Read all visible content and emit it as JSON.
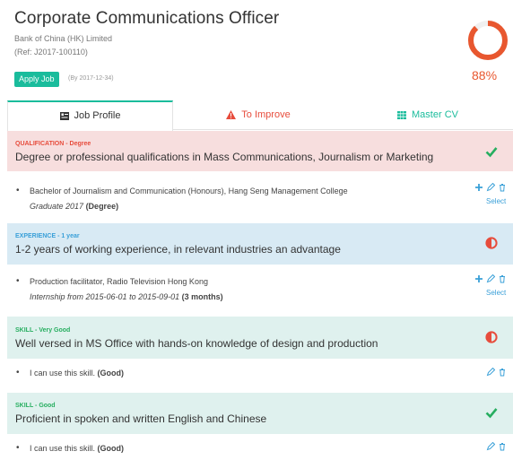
{
  "header": {
    "title": "Corporate Communications Officer",
    "company": "Bank of China (HK) Limited",
    "ref": "(Ref: J2017-100110)",
    "apply_label": "Apply Job",
    "deadline": "(By 2017-12-34)",
    "match_percent_label": "88%",
    "match_fraction": 0.88
  },
  "colors": {
    "accent": "#1abc9c",
    "danger": "#e74c3c",
    "gauge": "#e8572f",
    "link": "#3aa0d8"
  },
  "tabs": [
    {
      "label": "Job Profile",
      "icon": "profile-card-icon"
    },
    {
      "label": "To Improve",
      "icon": "warning-icon"
    },
    {
      "label": "Master CV",
      "icon": "grid-icon"
    }
  ],
  "requirements": [
    {
      "type_label": "QUALIFICATION - Degree",
      "text": "Degree or professional qualifications in Mass Communications, Journalism or Marketing",
      "status_icon": "check-icon",
      "entry": {
        "line": "Bachelor of Journalism and Communication (Honours), Hang Seng Management College",
        "sub_italic": "Graduate 2017",
        "sub_bold": "(Degree)",
        "select_label": "Select"
      }
    },
    {
      "type_label": "EXPERIENCE - 1 year",
      "text": "1-2 years of working experience, in relevant industries an advantage",
      "status_icon": "half-circle-icon",
      "entry": {
        "line": "Production facilitator, Radio Television Hong Kong",
        "sub_italic": "Internship from 2015-06-01 to 2015-09-01",
        "sub_bold": "(3 months)",
        "select_label": "Select"
      }
    },
    {
      "type_label": "SKILL - Very Good",
      "text": "Well versed in MS Office with hands-on knowledge of design and production",
      "status_icon": "half-circle-icon",
      "entry": {
        "line": "I can use this skill.",
        "line_bold": "(Good)"
      }
    },
    {
      "type_label": "SKILL - Good",
      "text": "Proficient in spoken and written English and Chinese",
      "status_icon": "check-icon",
      "entry": {
        "line": "I can use this skill.",
        "line_bold": "(Good)"
      }
    }
  ]
}
